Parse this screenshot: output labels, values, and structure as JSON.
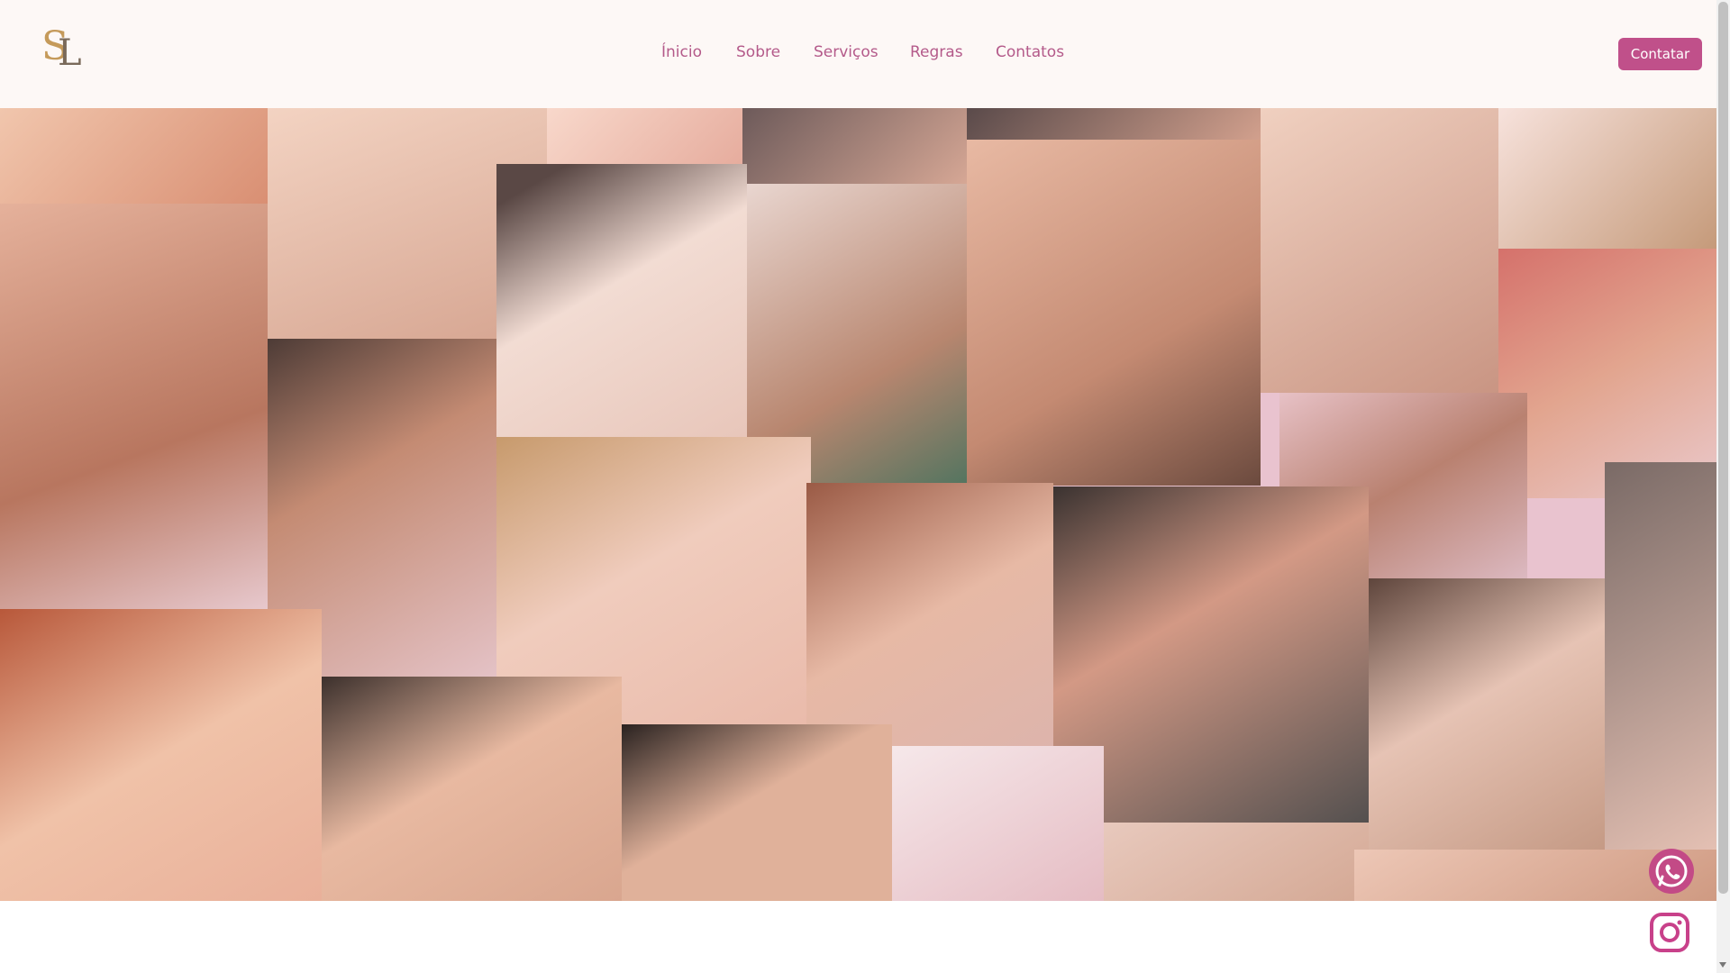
{
  "brand": {
    "logo_letters": "SL"
  },
  "nav": {
    "items": [
      {
        "label": "Ínicio"
      },
      {
        "label": "Sobre"
      },
      {
        "label": "Serviços"
      },
      {
        "label": "Regras"
      },
      {
        "label": "Contatos"
      }
    ]
  },
  "header": {
    "contact_button_label": "Contatar"
  },
  "gallery": {
    "description_visible": false
  },
  "floating": {
    "whatsapp_icon": "whatsapp-icon",
    "instagram_icon": "instagram-icon"
  },
  "colors": {
    "accent": "#c0508a",
    "nav_text": "#b45a8a",
    "header_bg": "#fdf8f6"
  }
}
